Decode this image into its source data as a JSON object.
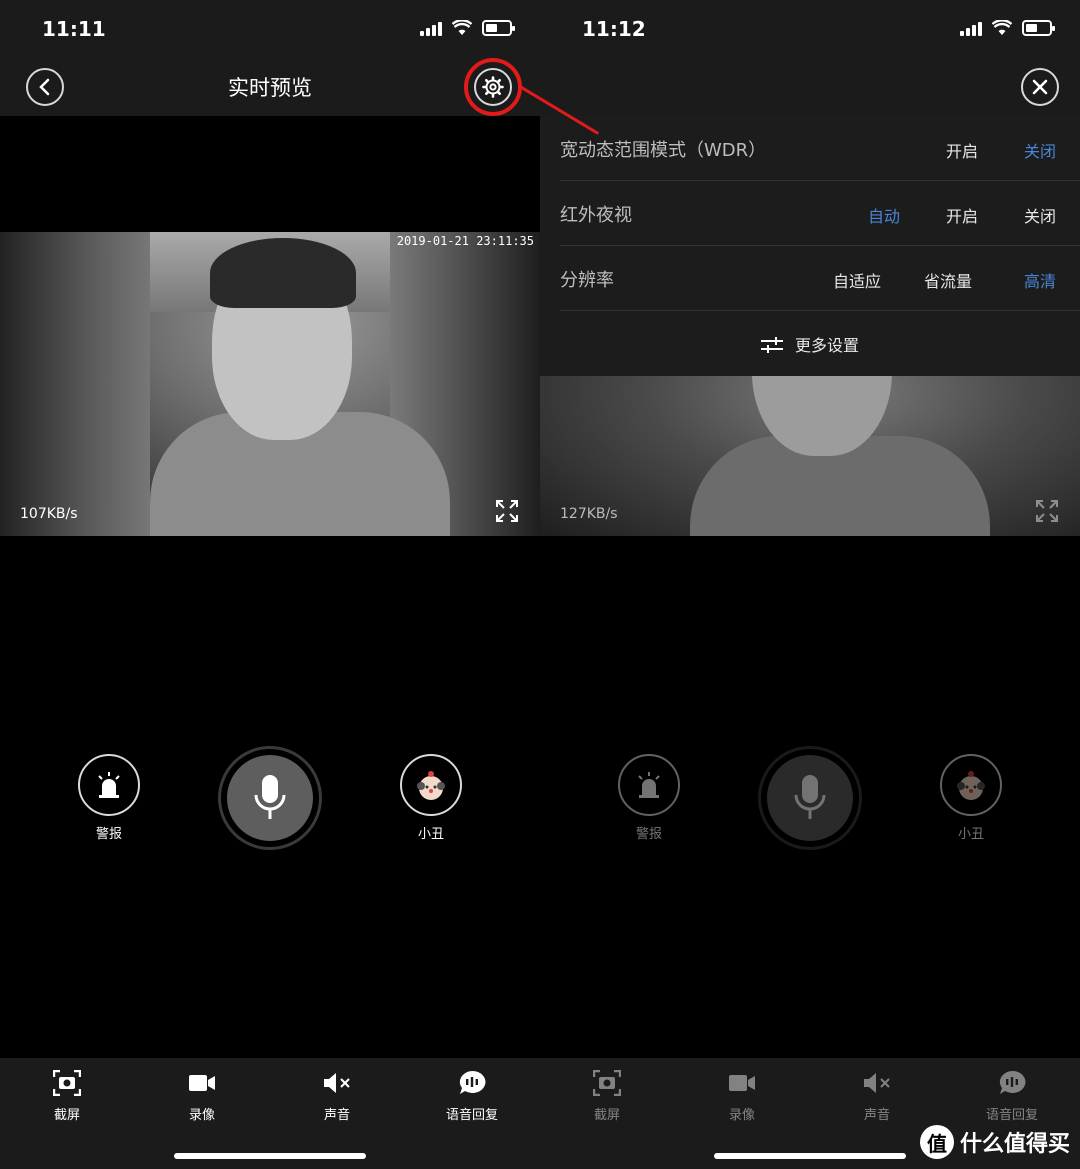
{
  "left": {
    "status": {
      "time": "11:11"
    },
    "nav": {
      "title": "实时预览"
    },
    "video": {
      "timestamp": "2019-01-21 23:11:35",
      "speed": "107KB/s"
    },
    "controls": {
      "alarm_label": "警报",
      "clown_label": "小丑"
    },
    "toolbar": {
      "screenshot": "截屏",
      "record": "录像",
      "sound": "声音",
      "voice_reply": "语音回复"
    }
  },
  "right": {
    "status": {
      "time": "11:12"
    },
    "settings": {
      "wdr": {
        "title": "宽动态范围模式（WDR）",
        "options": [
          "开启",
          "关闭"
        ],
        "selected": "关闭"
      },
      "night_vision": {
        "title": "红外夜视",
        "options": [
          "自动",
          "开启",
          "关闭"
        ],
        "selected": "自动"
      },
      "resolution": {
        "title": "分辨率",
        "options": [
          "自适应",
          "省流量",
          "高清"
        ],
        "selected": "高清"
      },
      "more": "更多设置"
    },
    "video": {
      "speed": "127KB/s"
    },
    "controls": {
      "alarm_label": "警报",
      "clown_label": "小丑"
    },
    "toolbar": {
      "screenshot": "截屏",
      "record": "录像",
      "sound": "声音",
      "voice_reply": "语音回复"
    }
  },
  "watermark": {
    "badge": "值",
    "text": "什么值得买"
  },
  "colors": {
    "accent": "#4a86d8",
    "highlight": "#e11a1a"
  }
}
